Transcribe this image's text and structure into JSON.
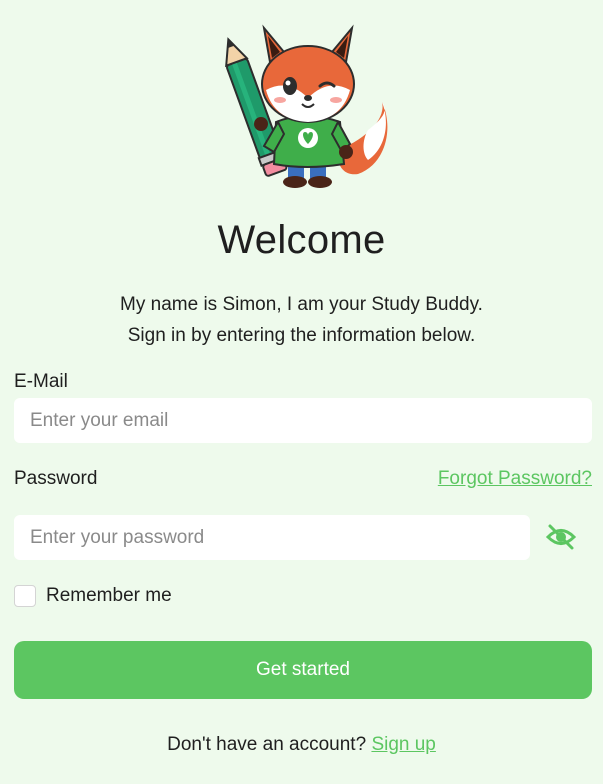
{
  "header": {
    "title": "Welcome",
    "subtitle_line1": "My name is Simon, I am your Study Buddy.",
    "subtitle_line2": "Sign in by entering the information below."
  },
  "mascot": {
    "icon": "fox-mascot-icon"
  },
  "form": {
    "email_label": "E-Mail",
    "email_placeholder": "Enter your email",
    "email_value": "",
    "password_label": "Password",
    "forgot_label": "Forgot Password?",
    "password_placeholder": "Enter your password",
    "password_value": "",
    "password_toggle_icon": "eye-off-icon",
    "remember_label": "Remember me",
    "remember_checked": false,
    "submit_label": "Get started"
  },
  "footer": {
    "prompt": "Don't have an account?",
    "signup_label": "Sign up"
  },
  "colors": {
    "background": "#eefaec",
    "accent": "#5cc661",
    "text": "#1f1f1f"
  }
}
